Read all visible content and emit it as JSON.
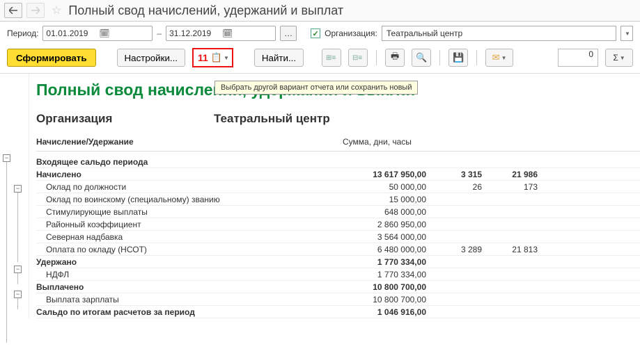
{
  "title": "Полный свод начислений, удержаний и выплат",
  "period_label": "Период:",
  "date_from": "01.01.2019",
  "date_to": "31.12.2019",
  "org_checkbox_label": "Организация:",
  "org_value": "Театральный центр",
  "btn_generate": "Сформировать",
  "btn_settings": "Настройки...",
  "red_number": "11",
  "btn_find": "Найти...",
  "num_field": "0",
  "sigma": "Σ",
  "tooltip": "Выбрать другой вариант отчета или сохранить новый",
  "report": {
    "title": "Полный свод начислений, удержаний и выплат",
    "org_label": "Организация",
    "org_name": "Театральный центр",
    "col_name": "Начисление/Удержание",
    "col_sum": "Сумма, дни, часы",
    "rows": [
      {
        "name": "Входящее сальдо периода",
        "bold": true,
        "indent": false,
        "sum": "",
        "d1": "",
        "d2": ""
      },
      {
        "name": "Начислено",
        "bold": true,
        "indent": false,
        "sum": "13 617 950,00",
        "d1": "3 315",
        "d2": "21 986"
      },
      {
        "name": "Оклад по должности",
        "bold": false,
        "indent": true,
        "sum": "50 000,00",
        "d1": "26",
        "d2": "173"
      },
      {
        "name": "Оклад по воинскому (специальному) званию",
        "bold": false,
        "indent": true,
        "sum": "15 000,00",
        "d1": "",
        "d2": ""
      },
      {
        "name": "Стимулирующие выплаты",
        "bold": false,
        "indent": true,
        "sum": "648 000,00",
        "d1": "",
        "d2": ""
      },
      {
        "name": "Районный коэффициент",
        "bold": false,
        "indent": true,
        "sum": "2 860 950,00",
        "d1": "",
        "d2": ""
      },
      {
        "name": "Северная надбавка",
        "bold": false,
        "indent": true,
        "sum": "3 564 000,00",
        "d1": "",
        "d2": ""
      },
      {
        "name": "Оплата по окладу (НСОТ)",
        "bold": false,
        "indent": true,
        "sum": "6 480 000,00",
        "d1": "3 289",
        "d2": "21 813"
      },
      {
        "name": "Удержано",
        "bold": true,
        "indent": false,
        "sum": "1 770 334,00",
        "d1": "",
        "d2": ""
      },
      {
        "name": "НДФЛ",
        "bold": false,
        "indent": true,
        "sum": "1 770 334,00",
        "d1": "",
        "d2": ""
      },
      {
        "name": "Выплачено",
        "bold": true,
        "indent": false,
        "sum": "10 800 700,00",
        "d1": "",
        "d2": ""
      },
      {
        "name": "Выплата зарплаты",
        "bold": false,
        "indent": true,
        "sum": "10 800 700,00",
        "d1": "",
        "d2": ""
      },
      {
        "name": "Сальдо по итогам расчетов за период",
        "bold": true,
        "indent": false,
        "sum": "1 046 916,00",
        "d1": "",
        "d2": ""
      }
    ]
  }
}
